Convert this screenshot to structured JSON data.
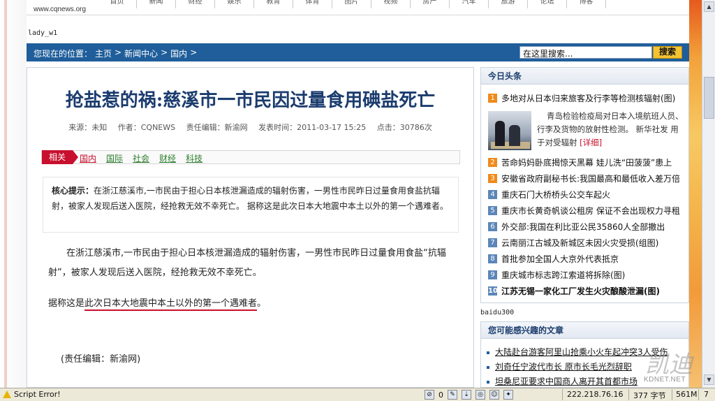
{
  "top": {
    "site_url": "www.cqnews.org",
    "nav": [
      "首页",
      "新闻",
      "财经",
      "娱乐",
      "教育",
      "体育",
      "图片",
      "视频",
      "房产",
      "汽车",
      "旅游",
      "论坛",
      "博客"
    ]
  },
  "lady": "lady_w1",
  "breadcrumb": {
    "prefix": "您现在的位置：",
    "items": [
      "主页",
      "新闻中心",
      "国内"
    ],
    "sep": ">"
  },
  "search": {
    "placeholder": "在这里搜索...",
    "button": "搜索"
  },
  "article": {
    "title": "抢盐惹的祸:慈溪市一市民因过量食用碘盐死亡",
    "meta": {
      "source": "来源：未知",
      "author": "作者：CQNEWS",
      "editor": "责任编辑：新渝网",
      "time": "发表时间：2011-03-17 15:25",
      "clicks": "点击：30786次"
    },
    "related_label": "相关",
    "related_tags": [
      "国内",
      "国际",
      "社会",
      "财经",
      "科技"
    ],
    "summary_label": "核心提示：",
    "summary_text": "在浙江慈溪市,一市民由于担心日本核泄漏造成的辐射伤害，一男性市民昨日过量食用食盐抗辐射，被家人发现后送入医院，经抢救无效不幸死亡。 据称这是此次日本大地震中本土以外的第一个遇难者。",
    "paragraph": "在浙江慈溪市,一市民由于担心日本核泄漏造成的辐射伤害，一男性市民昨日过量食用食盐“抗辐射”，被家人发现后送入医院，经抢救无效不幸死亡。",
    "note_prefix": "据称这是",
    "note_underlined": "此次日本大地震中本土以外的第一个遇难者",
    "note_suffix": "。",
    "editor_line": "(责任编辑：新渝网)"
  },
  "headlines": {
    "title": "今日头条",
    "first": "多地对从日本归来旅客及行李等检测核辐射(图)",
    "feature_text": "青岛检验检疫局对日本入境航班人员、行李及货物的放射性检测。 新华社发 用于对受辐射",
    "feature_more": "[详细]",
    "items": [
      {
        "n": "2",
        "text": "苦命妈妈卧底揭惊天黑幕 娃儿洗“田菠菠”患上",
        "bold": false
      },
      {
        "n": "3",
        "text": "安徽省政府副秘书长:我国最高和最低收入差万倍",
        "bold": false
      },
      {
        "n": "4",
        "text": "重庆石门大桥桥头公交车起火",
        "bold": false
      },
      {
        "n": "5",
        "text": "重庆市长黄奇帆谈公租房 保证不会出现权力寻租",
        "bold": false
      },
      {
        "n": "6",
        "text": "外交部:我国在利比亚公民35860人全部撤出",
        "bold": false
      },
      {
        "n": "7",
        "text": "云南丽江古城及新城区未因火灾受损(组图)",
        "bold": false
      },
      {
        "n": "8",
        "text": "首批参加全国人大京外代表抵京",
        "bold": false
      },
      {
        "n": "9",
        "text": "重庆城市标志跨江索道将拆除(图)",
        "bold": false
      },
      {
        "n": "10",
        "text": "江苏无锡一家化工厂发生火灾酿酸泄漏(图)",
        "bold": true
      }
    ]
  },
  "baidu": "baidu300",
  "interest": {
    "title": "您可能感兴趣的文章",
    "items": [
      "大陆赴台游客阿里山抢乘小火车起冲突3人受伤",
      "刘奇任宁波代市长 原市长毛光烈辞职",
      "坦桑尼亚要求中国商人离开其首都市场"
    ]
  },
  "watermark": {
    "glyph": "凯迪",
    "text": "KDNET.NET"
  },
  "status": {
    "error": "Script Error!",
    "count": "0",
    "ip": "222.218.76.16",
    "bytes": "377 字节",
    "mem": "561M",
    "num": "7"
  },
  "colors": {
    "brand_blue": "#1f5e9b",
    "title_blue": "#1b3c6e",
    "accent_red": "#c8102e",
    "search_yellow": "#f4c233"
  }
}
